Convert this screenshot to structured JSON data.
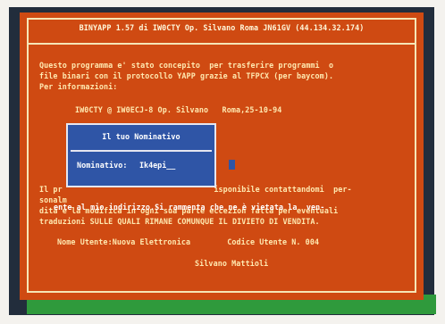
{
  "title": "BINYAPP 1.57 di IW0CTY Op. Silvano Roma JN61GV (44.134.32.174)",
  "intro": [
    "Questo programma e' stato concepito  per trasferire programmi  o",
    "file binari con il protocollo YAPP grazie al TFPCX (per baycom).",
    "Per informazioni:"
  ],
  "contact_line": "IW0CTY @ IW0ECJ-8 Op. Silvano   Roma,25-10-94",
  "dialog": {
    "title": "Il tuo Nominativo",
    "label": "Nominativo:",
    "value": "Ik4epi__"
  },
  "body": [
    "Il pr                                 isponibile contattandomi  per-",
    "sonalm",
    "dità e la modifica in ogni sua parte eccezion fatta per eventuali",
    "traduzioni SULLE QUALI RIMANE COMUNQUE IL DIVIETO DI VENDITA."
  ],
  "overlap_text": "ente al mio indirizzo.Si rammenta che ne è vietata la  ven-",
  "user_line": "Nome Utente:Nuova Elettronica        Codice Utente N. 004",
  "signature": "Silvano Mattioli",
  "colors": {
    "screen_bg": "#cf4a12",
    "text": "#ffe9b0",
    "dialog_bg": "#2f55a6",
    "bezel": "#222d3c"
  }
}
